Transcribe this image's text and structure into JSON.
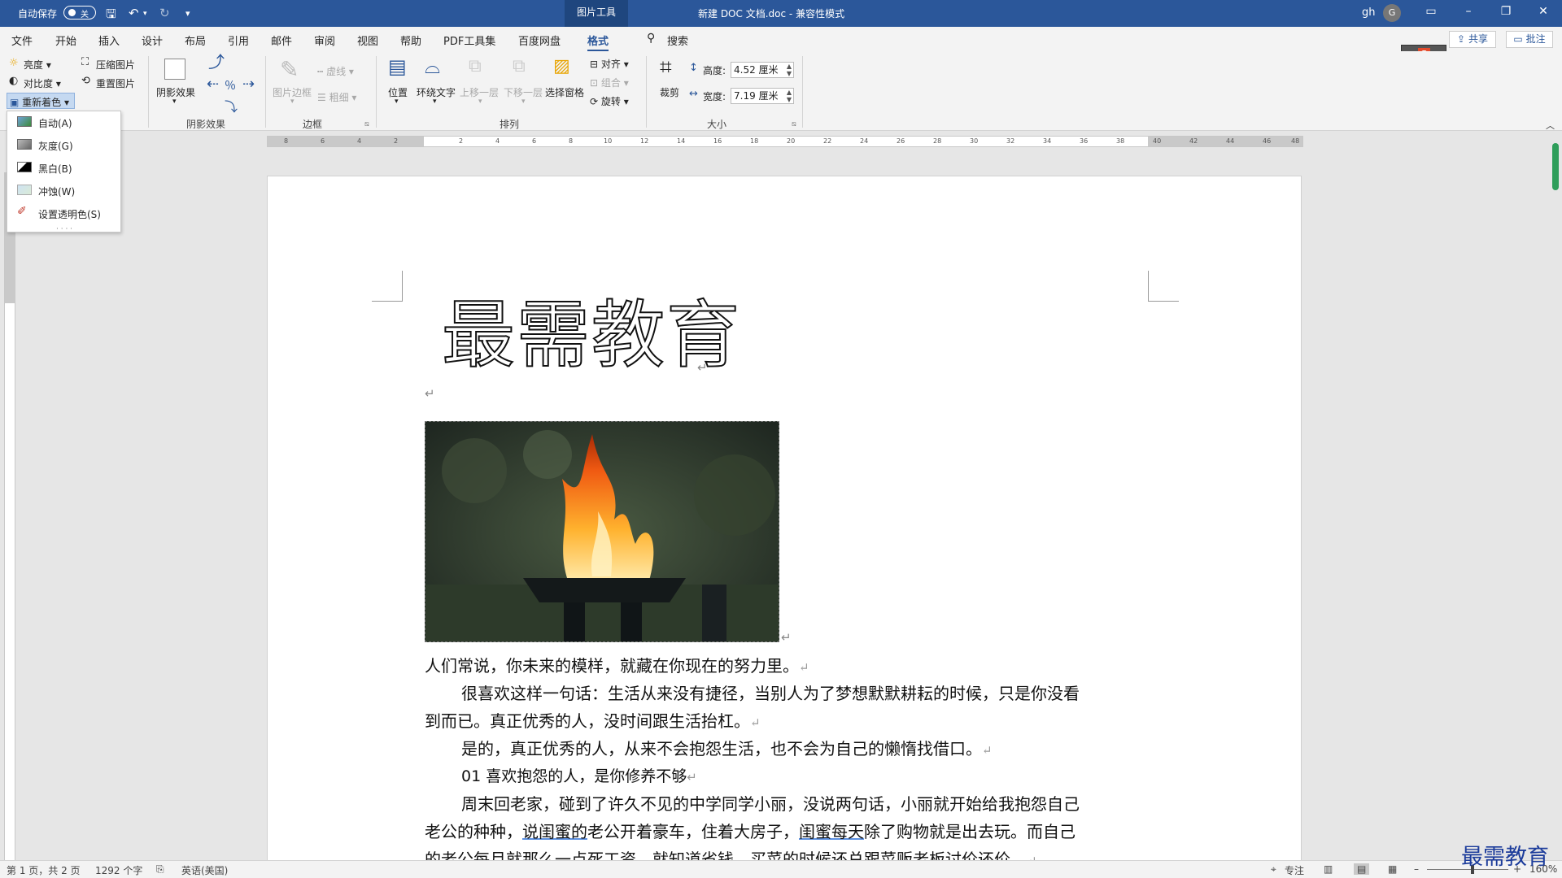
{
  "titlebar": {
    "autosave_label": "自动保存",
    "autosave_state": "关",
    "context_tab": "图片工具",
    "doc_title": "新建 DOC 文档.doc",
    "separator": "-",
    "compat_mode": "兼容性模式",
    "user_name": "gh",
    "avatar_letter": "G"
  },
  "menu": {
    "tabs": [
      "文件",
      "开始",
      "插入",
      "设计",
      "布局",
      "引用",
      "邮件",
      "审阅",
      "视图",
      "帮助",
      "PDF工具集",
      "百度网盘",
      "格式"
    ],
    "search_label": "搜索",
    "share_label": "共享",
    "comment_label": "批注"
  },
  "ribbon": {
    "adjust": {
      "brightness": "亮度",
      "contrast": "对比度",
      "recolor": "重新着色",
      "compress": "压缩图片",
      "reset": "重置图片"
    },
    "shadow": {
      "shadow_effects": "阴影效果",
      "group_label": "阴影效果"
    },
    "border": {
      "picture_border": "图片边框",
      "dashes": "虚线",
      "weight": "粗细",
      "group_label": "边框"
    },
    "arrange": {
      "position": "位置",
      "wrap_text": "环绕文字",
      "bring_forward": "上移一层",
      "send_backward": "下移一层",
      "selection_pane": "选择窗格",
      "align": "对齐",
      "group": "组合",
      "rotate": "旋转",
      "group_label": "排列"
    },
    "size": {
      "crop": "裁剪",
      "height_label": "高度:",
      "height_value": "4.52 厘米",
      "width_label": "宽度:",
      "width_value": "7.19 厘米",
      "group_label": "大小"
    }
  },
  "recolor_menu": {
    "items": [
      {
        "label": "自动(A)"
      },
      {
        "label": "灰度(G)"
      },
      {
        "label": "黑白(B)"
      },
      {
        "label": "冲蚀(W)"
      },
      {
        "label": "设置透明色(S)"
      }
    ]
  },
  "ruler": {
    "ticks": [
      "8",
      "6",
      "4",
      "2",
      "2",
      "4",
      "6",
      "8",
      "10",
      "12",
      "14",
      "16",
      "18",
      "20",
      "22",
      "24",
      "26",
      "28",
      "30",
      "32",
      "34",
      "36",
      "38",
      "40",
      "42",
      "44",
      "46",
      "48"
    ]
  },
  "document": {
    "title": "最需教育",
    "lines": [
      "人们常说，你未来的模样，就藏在你现在的努力里。",
      "很喜欢这样一句话：生活从来没有捷径，当别人为了梦想默默耕耘的时候，只是你没看",
      "到而已。真正优秀的人，没时间跟生活抬杠。",
      "是的，真正优秀的人，从来不会抱怨生活，也不会为自己的懒惰找借口。",
      "01  喜欢抱怨的人，是你修养不够",
      "周末回老家，碰到了许久不见的中学同学小丽，没说两句话，小丽就开始给我抱怨自己",
      "的老公每月就那么一点死工资，就知道省钱，买菜的时候还总跟菜贩老板讨价还价。"
    ],
    "line7": {
      "a": "老公的种种，",
      "b": "说闺蜜的",
      "c": "老公开着豪车，住着大房子，",
      "d": "闺蜜每天",
      "e": "除了购物就是出去玩。而自己"
    }
  },
  "statusbar": {
    "page": "第 1 页，共 2 页",
    "words": "1292 个字",
    "language": "英语(美国)",
    "focus": "专注",
    "zoom": "160%"
  },
  "watermark": "最需教育"
}
